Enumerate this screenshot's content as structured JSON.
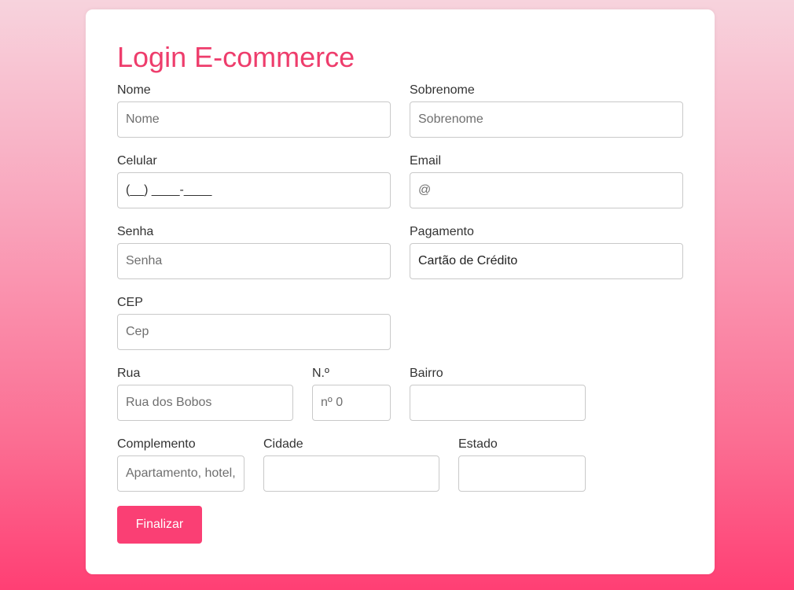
{
  "form": {
    "title": "Login E-commerce",
    "fields": {
      "nome": {
        "label": "Nome",
        "placeholder": "Nome",
        "value": ""
      },
      "sobrenome": {
        "label": "Sobrenome",
        "placeholder": "Sobrenome",
        "value": ""
      },
      "celular": {
        "label": "Celular",
        "placeholder": "",
        "value": "(__) ____-____"
      },
      "email": {
        "label": "Email",
        "placeholder": "@",
        "value": ""
      },
      "senha": {
        "label": "Senha",
        "placeholder": "Senha",
        "value": ""
      },
      "pagamento": {
        "label": "Pagamento",
        "selected": "Cartão de Crédito"
      },
      "cep": {
        "label": "CEP",
        "placeholder": "Cep",
        "value": ""
      },
      "rua": {
        "label": "Rua",
        "placeholder": "Rua dos Bobos",
        "value": ""
      },
      "numero": {
        "label": "N.º",
        "placeholder": "nº 0",
        "value": ""
      },
      "bairro": {
        "label": "Bairro",
        "placeholder": "",
        "value": ""
      },
      "complemento": {
        "label": "Complemento",
        "placeholder": "Apartamento, hotel, casa, etc.",
        "value": ""
      },
      "cidade": {
        "label": "Cidade",
        "placeholder": "",
        "value": ""
      },
      "estado": {
        "label": "Estado",
        "placeholder": "",
        "value": ""
      }
    },
    "submit_label": "Finalizar"
  },
  "colors": {
    "accent": "#ee3d6c",
    "button": "#fa3f74",
    "background_top": "#f7d3dd",
    "background_bottom": "#ff3f74"
  }
}
